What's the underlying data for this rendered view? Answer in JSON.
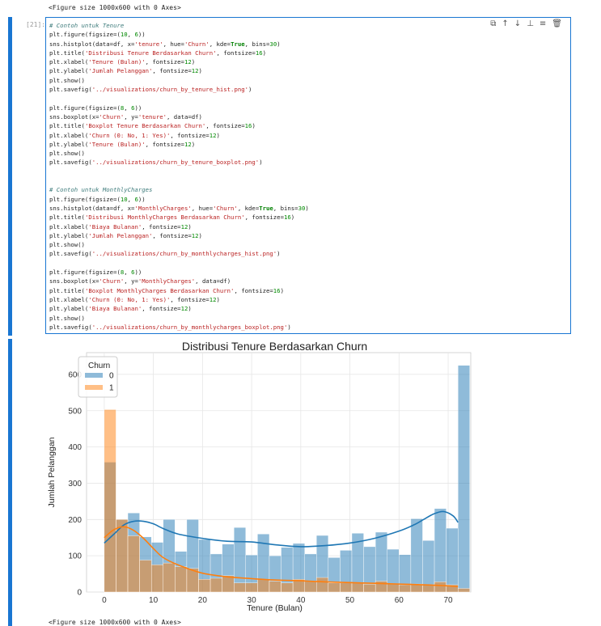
{
  "output_pre": "<Figure size 1000x600 with 0 Axes>",
  "output_post": "<Figure size 1000x600 with 0 Axes>",
  "cell": {
    "prompt": "[21]:",
    "toolbar": [
      {
        "name": "copy-icon",
        "glyph": "⧉"
      },
      {
        "name": "move-up-icon",
        "glyph": "↑"
      },
      {
        "name": "move-down-icon",
        "glyph": "↓"
      },
      {
        "name": "insert-below-icon",
        "glyph": "⊥"
      },
      {
        "name": "format-icon",
        "glyph": "≡"
      },
      {
        "name": "delete-icon",
        "glyph": "🗑"
      }
    ],
    "code_lines": [
      "# Contoh untuk Tenure",
      "plt.figure(figsize=(10, 6))",
      "sns.histplot(data=df, x='tenure', hue='Churn', kde=True, bins=30)",
      "plt.title('Distribusi Tenure Berdasarkan Churn', fontsize=16)",
      "plt.xlabel('Tenure (Bulan)', fontsize=12)",
      "plt.ylabel('Jumlah Pelanggan', fontsize=12)",
      "plt.show()",
      "plt.savefig('../visualizations/churn_by_tenure_hist.png')",
      "",
      "plt.figure(figsize=(8, 6))",
      "sns.boxplot(x='Churn', y='tenure', data=df)",
      "plt.title('Boxplot Tenure Berdasarkan Churn', fontsize=16)",
      "plt.xlabel('Churn (0: No, 1: Yes)', fontsize=12)",
      "plt.ylabel('Tenure (Bulan)', fontsize=12)",
      "plt.show()",
      "plt.savefig('../visualizations/churn_by_tenure_boxplot.png')",
      "",
      "",
      "# Contoh untuk MonthlyCharges",
      "plt.figure(figsize=(10, 6))",
      "sns.histplot(data=df, x='MonthlyCharges', hue='Churn', kde=True, bins=30)",
      "plt.title('Distribusi MonthlyCharges Berdasarkan Churn', fontsize=16)",
      "plt.xlabel('Biaya Bulanan', fontsize=12)",
      "plt.ylabel('Jumlah Pelanggan', fontsize=12)",
      "plt.show()",
      "plt.savefig('../visualizations/churn_by_monthlycharges_hist.png')",
      "",
      "plt.figure(figsize=(8, 6))",
      "sns.boxplot(x='Churn', y='MonthlyCharges', data=df)",
      "plt.title('Boxplot MonthlyCharges Berdasarkan Churn', fontsize=16)",
      "plt.xlabel('Churn (0: No, 1: Yes)', fontsize=12)",
      "plt.ylabel('Biaya Bulanan', fontsize=12)",
      "plt.show()",
      "plt.savefig('../visualizations/churn_by_monthlycharges_boxplot.png')"
    ]
  },
  "colors": {
    "accent": "#1976d2",
    "series0": "#1f77b4",
    "series1": "#ff7f0e"
  },
  "chart_data": {
    "type": "bar",
    "title": "Distribusi Tenure Berdasarkan Churn",
    "xlabel": "Tenure (Bulan)",
    "ylabel": "Jumlah Pelanggan",
    "xlim": [
      -3.6,
      74.6
    ],
    "ylim": [
      0,
      660
    ],
    "xticks": [
      0,
      10,
      20,
      30,
      40,
      50,
      60,
      70
    ],
    "yticks": [
      0,
      100,
      200,
      300,
      400,
      500,
      600
    ],
    "grid": true,
    "legend": {
      "title": "Churn",
      "placement": "top-left",
      "entries": [
        "0",
        "1"
      ]
    },
    "bin_start": 0,
    "bin_width": 2.4,
    "series": [
      {
        "name": "0",
        "values": [
          358,
          200,
          218,
          152,
          137,
          200,
          112,
          200,
          145,
          105,
          132,
          178,
          102,
          160,
          100,
          123,
          134,
          105,
          156,
          95,
          115,
          162,
          125,
          165,
          118,
          103,
          202,
          142,
          230,
          176,
          625
        ]
      },
      {
        "name": "1",
        "values": [
          503,
          200,
          155,
          88,
          75,
          80,
          70,
          65,
          35,
          38,
          45,
          25,
          25,
          35,
          30,
          25,
          35,
          30,
          40,
          25,
          25,
          25,
          22,
          30,
          22,
          20,
          22,
          20,
          28,
          20,
          10
        ]
      }
    ],
    "kde": [
      {
        "name": "0",
        "x": [
          0,
          2,
          4,
          6,
          8,
          10,
          12,
          15,
          20,
          25,
          30,
          35,
          40,
          45,
          50,
          55,
          60,
          63,
          65,
          67,
          69,
          71,
          72
        ],
        "y": [
          135,
          160,
          185,
          195,
          195,
          188,
          175,
          160,
          148,
          140,
          138,
          130,
          125,
          128,
          135,
          148,
          168,
          185,
          200,
          215,
          222,
          210,
          192
        ]
      },
      {
        "name": "1",
        "x": [
          0,
          2,
          4,
          6,
          8,
          10,
          12,
          15,
          20,
          25,
          30,
          35,
          40,
          45,
          50,
          55,
          60,
          65,
          70,
          72
        ],
        "y": [
          150,
          172,
          180,
          170,
          148,
          120,
          95,
          75,
          52,
          42,
          37,
          33,
          31,
          28,
          26,
          24,
          22,
          20,
          17,
          15
        ]
      }
    ]
  }
}
